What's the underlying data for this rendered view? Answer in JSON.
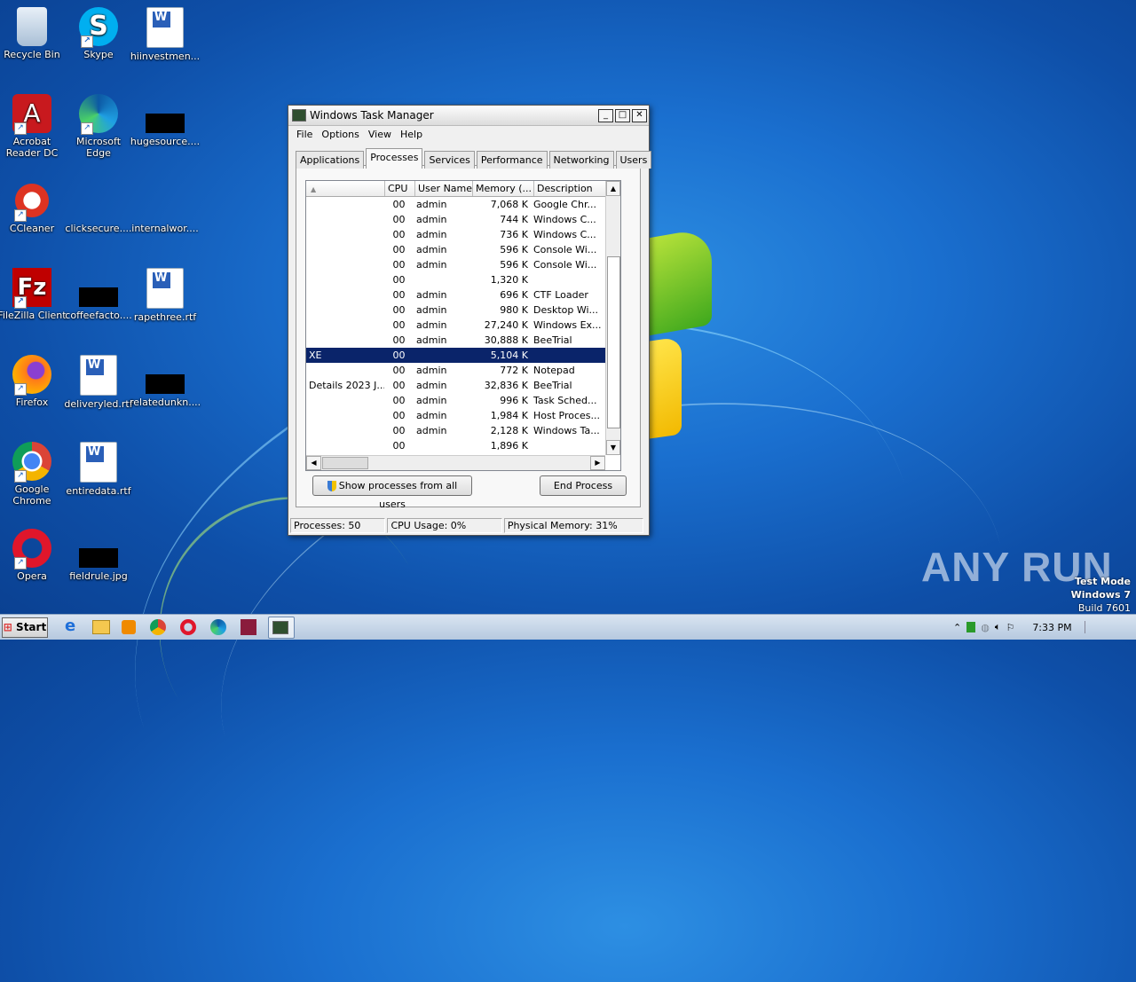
{
  "desktop": {
    "icons": [
      {
        "label": "Recycle Bin"
      },
      {
        "label": "Skype"
      },
      {
        "label": "hiinvestmen..."
      },
      {
        "label": "Acrobat Reader DC"
      },
      {
        "label": "Microsoft Edge"
      },
      {
        "label": "hugesource...."
      },
      {
        "label": "CCleaner"
      },
      {
        "label": "clicksecure...."
      },
      {
        "label": "internalwor...."
      },
      {
        "label": "FileZilla Client"
      },
      {
        "label": "coffeefacto...."
      },
      {
        "label": "rapethree.rtf"
      },
      {
        "label": "Firefox"
      },
      {
        "label": "deliveryled.rtf"
      },
      {
        "label": "relatedunkn...."
      },
      {
        "label": "Google Chrome"
      },
      {
        "label": "entiredata.rtf"
      },
      {
        "label": "Opera"
      },
      {
        "label": "fieldrule.jpg"
      }
    ]
  },
  "taskmanager": {
    "title": "Windows Task Manager",
    "menu": [
      "File",
      "Options",
      "View",
      "Help"
    ],
    "tabs": [
      "Applications",
      "Processes",
      "Services",
      "Performance",
      "Networking",
      "Users"
    ],
    "active_tab": "Processes",
    "columns": [
      "",
      "CPU",
      "User Name",
      "Memory (...",
      "Description"
    ],
    "rows": [
      {
        "name": "",
        "cpu": "00",
        "user": "admin",
        "mem": "7,068 K",
        "desc": "Google Chr..."
      },
      {
        "name": "",
        "cpu": "00",
        "user": "admin",
        "mem": "744 K",
        "desc": "Windows C..."
      },
      {
        "name": "",
        "cpu": "00",
        "user": "admin",
        "mem": "736 K",
        "desc": "Windows C..."
      },
      {
        "name": "",
        "cpu": "00",
        "user": "admin",
        "mem": "596 K",
        "desc": "Console Wi..."
      },
      {
        "name": "",
        "cpu": "00",
        "user": "admin",
        "mem": "596 K",
        "desc": "Console Wi..."
      },
      {
        "name": "",
        "cpu": "00",
        "user": "",
        "mem": "1,320 K",
        "desc": ""
      },
      {
        "name": "",
        "cpu": "00",
        "user": "admin",
        "mem": "696 K",
        "desc": "CTF Loader"
      },
      {
        "name": "",
        "cpu": "00",
        "user": "admin",
        "mem": "980 K",
        "desc": "Desktop Wi..."
      },
      {
        "name": "",
        "cpu": "00",
        "user": "admin",
        "mem": "27,240 K",
        "desc": "Windows Ex..."
      },
      {
        "name": "",
        "cpu": "00",
        "user": "admin",
        "mem": "30,888 K",
        "desc": "BeeTrial"
      },
      {
        "name": "XE",
        "cpu": "00",
        "user": "",
        "mem": "5,104 K",
        "desc": "",
        "selected": true
      },
      {
        "name": "",
        "cpu": "00",
        "user": "admin",
        "mem": "772 K",
        "desc": "Notepad"
      },
      {
        "name": "Details 2023 J...",
        "cpu": "00",
        "user": "admin",
        "mem": "32,836 K",
        "desc": "BeeTrial"
      },
      {
        "name": "",
        "cpu": "00",
        "user": "admin",
        "mem": "996 K",
        "desc": "Task Sched..."
      },
      {
        "name": "",
        "cpu": "00",
        "user": "admin",
        "mem": "1,984 K",
        "desc": "Host Proces..."
      },
      {
        "name": "",
        "cpu": "00",
        "user": "admin",
        "mem": "2,128 K",
        "desc": "Windows Ta..."
      },
      {
        "name": "",
        "cpu": "00",
        "user": "",
        "mem": "1,896 K",
        "desc": ""
      }
    ],
    "show_all_label": "Show processes from all users",
    "end_process_label": "End Process",
    "status": {
      "processes": "Processes: 50",
      "cpu": "CPU Usage: 0%",
      "memory": "Physical Memory: 31%"
    }
  },
  "taskbar": {
    "start_label": "Start",
    "clock": "7:33 PM"
  },
  "watermark": "ANY RUN",
  "testmode": {
    "line1": "Test Mode",
    "line2": "Windows 7",
    "line3": "Build 7601"
  }
}
